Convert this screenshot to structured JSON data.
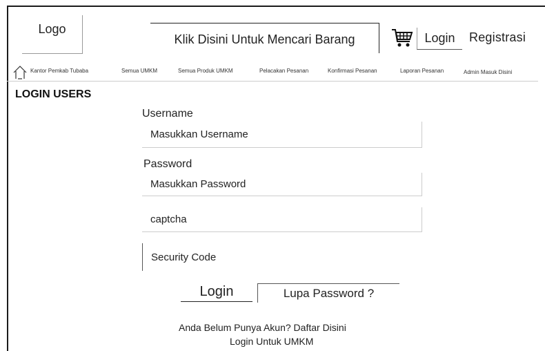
{
  "header": {
    "logo": "Logo",
    "search_placeholder": "Klik Disini Untuk Mencari Barang",
    "cart_icon": "shopping-cart-icon",
    "login": "Login",
    "register": "Registrasi"
  },
  "nav": {
    "home_icon": "home-icon",
    "items": [
      "Kantor Pemkab Tubaba",
      "Semua UMKM",
      "Semua Produk UMKM",
      "Pelacakan Pesanan",
      "Konfirmasi Pesanan",
      "Laporan Pesanan",
      "Admin Masuk Disini"
    ]
  },
  "form": {
    "title": "LOGIN USERS",
    "username_label": "Username",
    "username_placeholder": "Masukkan Username",
    "password_label": "Password",
    "password_placeholder": "Masukkan Password",
    "captcha_placeholder": "captcha",
    "security_code": "Security Code",
    "login_button": "Login",
    "forgot_button": "Lupa Password ?",
    "no_account_text": "Anda Belum Punya Akun? Daftar Disini",
    "umkm_login_text": "Login Untuk UMKM"
  }
}
